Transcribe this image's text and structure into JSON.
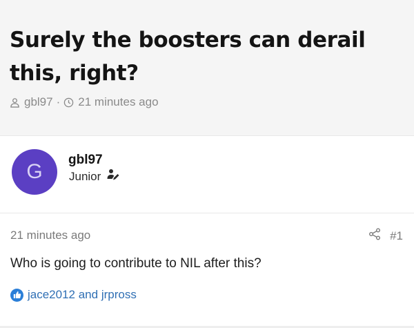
{
  "thread": {
    "title": "Surely the boosters can derail this, right?",
    "starter": "gbl97",
    "separator": "·",
    "time": "21 minutes ago"
  },
  "author": {
    "avatar_letter": "G",
    "username": "gbl97",
    "user_title": "Junior",
    "avatar_color": "#5b3fc3"
  },
  "post": {
    "date": "21 minutes ago",
    "post_number": "#1",
    "body": "Who is going to contribute to NIL after this?",
    "reactions": {
      "users": "jace2012 and jrpross",
      "icon": "thumbs-up-icon"
    }
  },
  "colors": {
    "header_bg": "#f5f5f5",
    "link": "#2f6fb4",
    "meta": "#8a8a8a"
  }
}
